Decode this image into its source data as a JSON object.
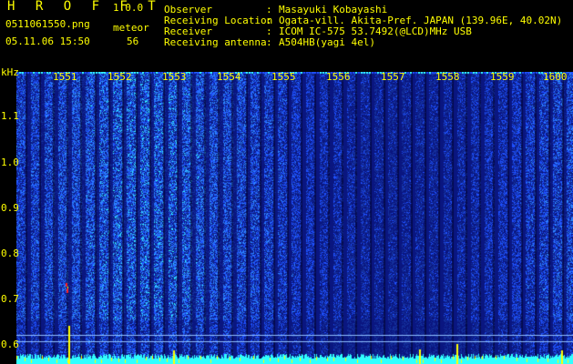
{
  "app": {
    "title": "H R O F F T",
    "version": "1.0.0"
  },
  "capture": {
    "file_name": "0511061550.png",
    "date_time": "05.11.06 15:50",
    "meteor_label": "meteor",
    "meteor_count": "56"
  },
  "info": {
    "rows": [
      {
        "key": "Observer",
        "sep": ":",
        "value": "Masayuki Kobayashi"
      },
      {
        "key": "Receiving Location",
        "sep": ":",
        "value": "Ogata-vill. Akita-Pref. JAPAN (139.96E, 40.02N)"
      },
      {
        "key": "Receiver",
        "sep": ":",
        "value": "ICOM IC-575 53.7492(@LCD)MHz USB"
      },
      {
        "key": "Receiving antenna",
        "sep": ":",
        "value": "A504HB(yagi 4el)"
      }
    ]
  },
  "axis": {
    "y_unit": "kHz",
    "y_ticks": [
      "1.1",
      "1.0",
      "0.9",
      "0.8",
      "0.7",
      "0.6"
    ],
    "x_ticks": [
      "1551",
      "1552",
      "1553",
      "1554",
      "1555",
      "1556",
      "1557",
      "1558",
      "1559",
      "1600"
    ]
  },
  "colors": {
    "header_text": "#ffff00",
    "axis_text": "#20ffff",
    "background": "#000000",
    "spectrum_dark": "#0a1680",
    "spectrum_mid": "#1e50ff",
    "spectrum_hot": "#30ffff",
    "spectrum_peak": "#ffff00",
    "spectrum_meteor": "#ff2020"
  }
}
